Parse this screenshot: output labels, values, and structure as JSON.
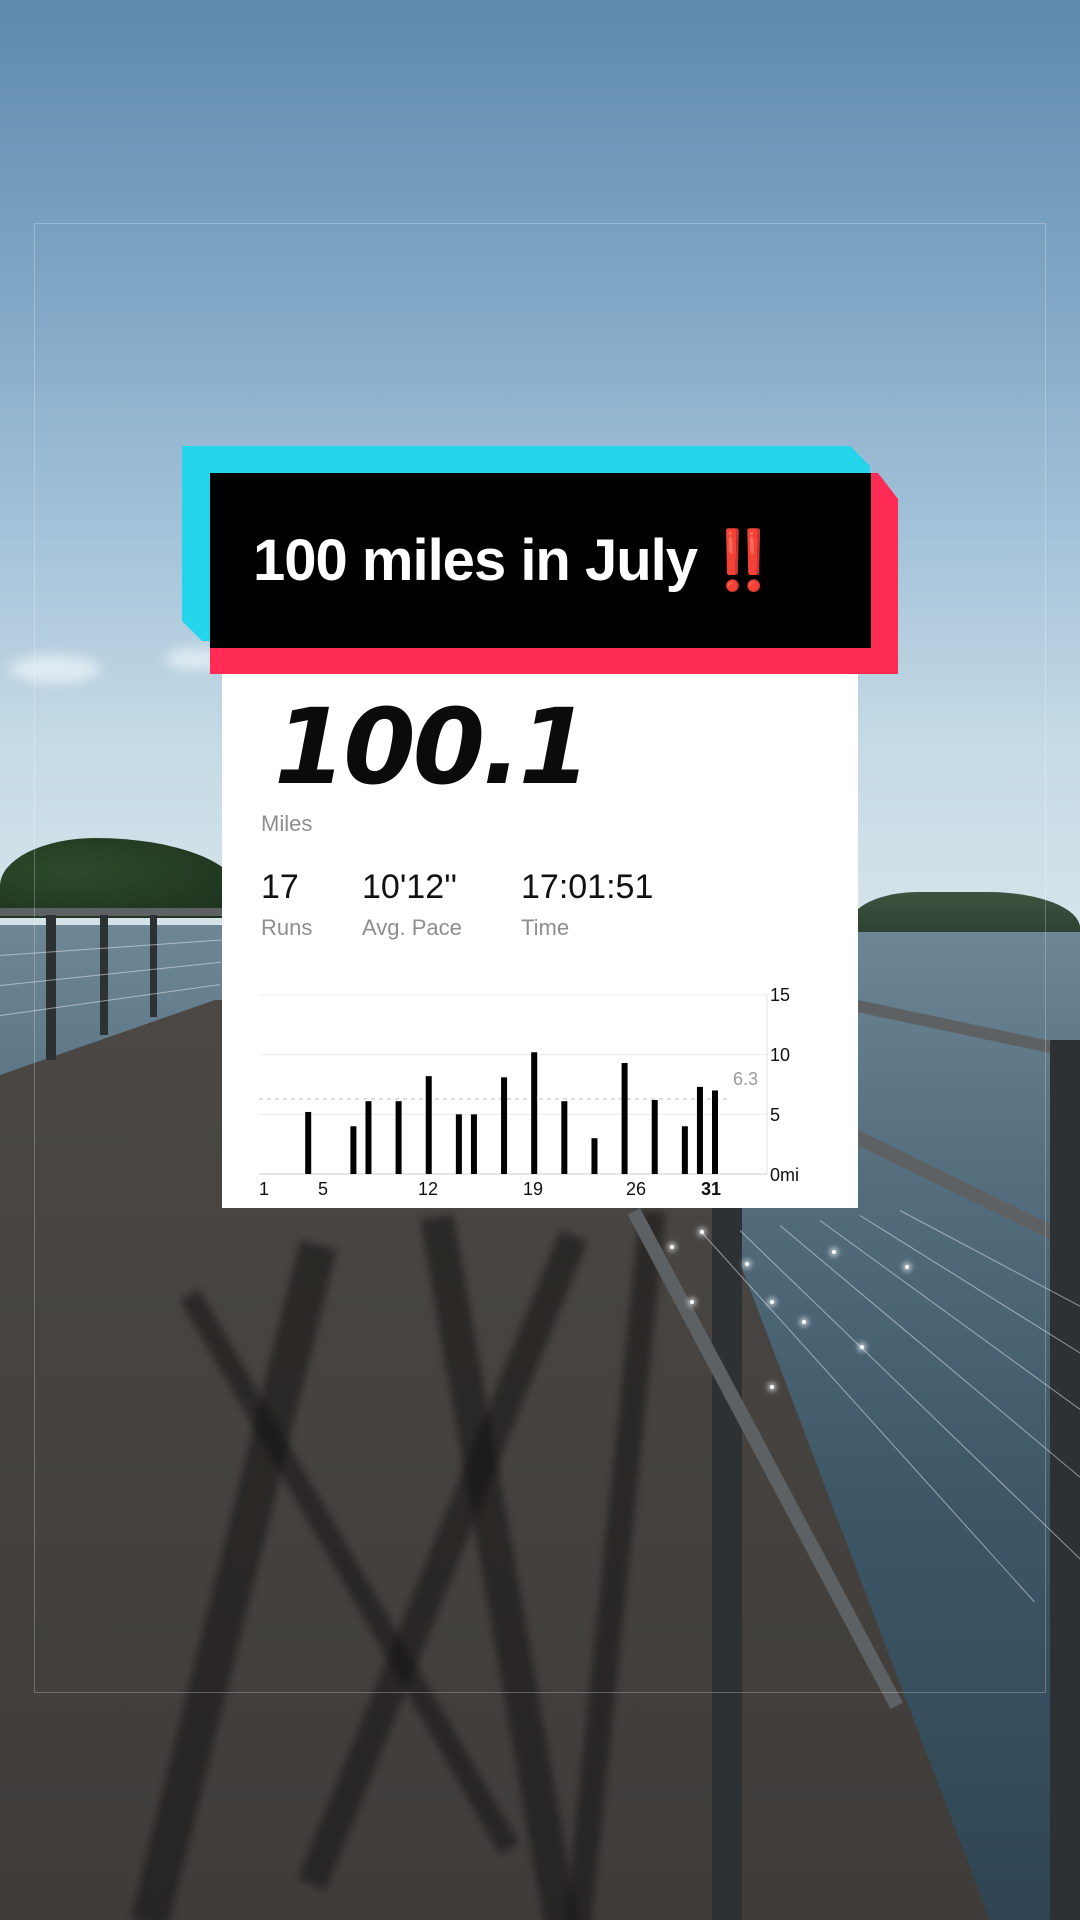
{
  "banner": {
    "text": "100 miles in July",
    "emphasis": "‼️"
  },
  "summary": {
    "distance": "100.1",
    "distance_unit": "Miles",
    "stats": [
      {
        "value": "17",
        "label": "Runs"
      },
      {
        "value": "10'12''",
        "label": "Avg. Pace"
      },
      {
        "value": "17:01:51",
        "label": "Time"
      }
    ]
  },
  "colors": {
    "cyan": "#25d5ec",
    "red": "#fe2c55",
    "bar": "#000000",
    "avg_line": "#bdbdbd"
  },
  "chart_data": {
    "type": "bar",
    "x_ticks": [
      "1",
      "5",
      "12",
      "19",
      "26",
      "31"
    ],
    "y_ticks": [
      "15",
      "10",
      "5",
      "0mi"
    ],
    "ylim": [
      0,
      15
    ],
    "xlim": [
      1,
      31
    ],
    "average_label": "6.3",
    "average": 6.3,
    "series": [
      {
        "days": [
          4,
          7,
          8,
          10,
          12,
          14,
          15,
          17,
          19,
          21,
          23,
          25,
          27,
          29,
          30,
          31
        ],
        "values": [
          5.2,
          4.0,
          6.1,
          6.1,
          8.2,
          5.0,
          5.0,
          8.1,
          10.2,
          6.1,
          3.0,
          9.3,
          6.2,
          4.0,
          7.3,
          7.0
        ]
      }
    ]
  }
}
